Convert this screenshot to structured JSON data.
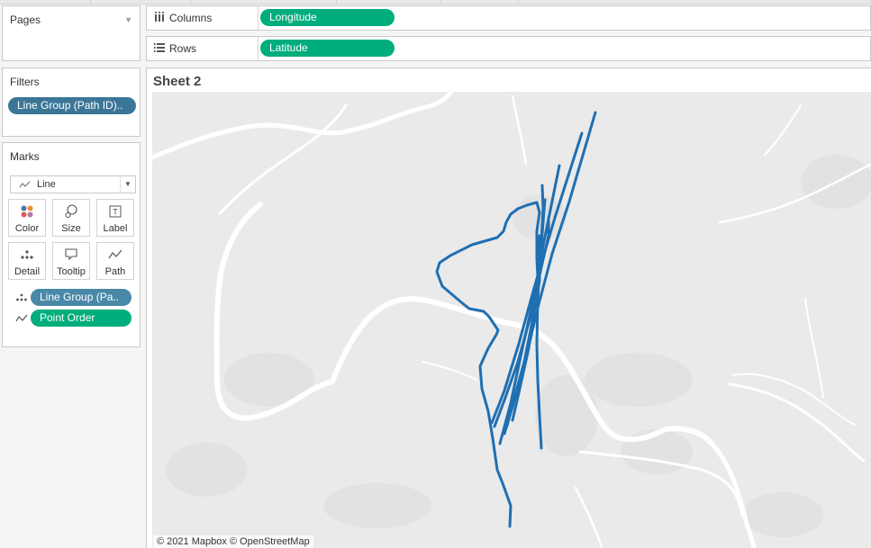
{
  "pages": {
    "title": "Pages"
  },
  "filters": {
    "title": "Filters",
    "pill": "Line Group (Path ID).."
  },
  "marks": {
    "title": "Marks",
    "type": "Line",
    "buttons": {
      "color": "Color",
      "size": "Size",
      "label": "Label",
      "detail": "Detail",
      "tooltip": "Tooltip",
      "path": "Path"
    },
    "fields": [
      {
        "icon": "detail-icon",
        "label": "Line Group (Pa.."
      },
      {
        "icon": "path-icon",
        "label": "Point Order"
      }
    ]
  },
  "shelves": {
    "columns": {
      "label": "Columns",
      "pill": "Longitude"
    },
    "rows": {
      "label": "Rows",
      "pill": "Latitude"
    }
  },
  "sheet": {
    "title": "Sheet 2",
    "attribution": "© 2021 Mapbox © OpenStreetMap"
  },
  "colors": {
    "line": "#1f6fb2",
    "dimension_pill": "#4a88a8",
    "measure_pill": "#00ad7c",
    "map_bg": "#eaeaea",
    "river": "#ffffff"
  }
}
